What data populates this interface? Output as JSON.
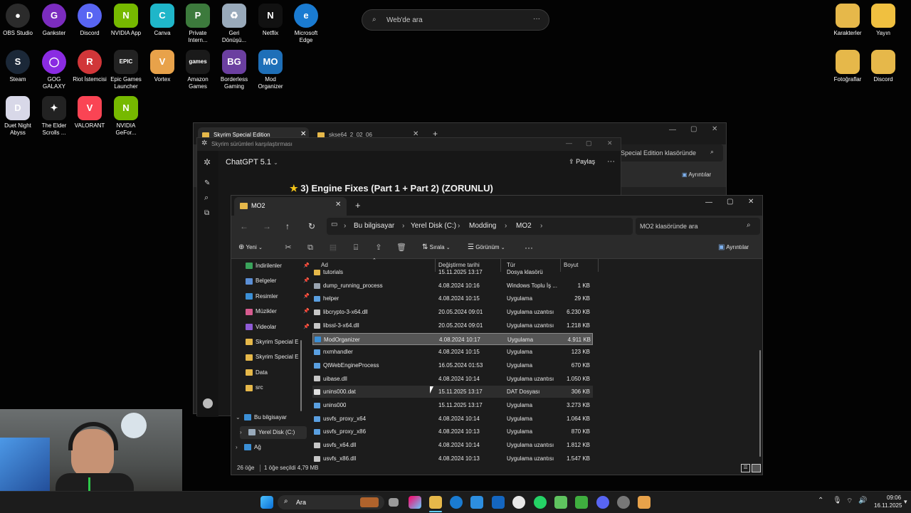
{
  "desktop_icons": [
    {
      "id": "obs",
      "label": "OBS Studio",
      "color": "#2b2b2b",
      "glyph": "●"
    },
    {
      "id": "gankster",
      "label": "Gankster",
      "color": "#7b2cbf",
      "glyph": "G"
    },
    {
      "id": "discord",
      "label": "Discord",
      "color": "#5865f2",
      "glyph": "D"
    },
    {
      "id": "nvidia",
      "label": "NVIDIA App",
      "color": "#76b900",
      "glyph": "N"
    },
    {
      "id": "canva",
      "label": "Canva",
      "color": "#1fb6c9",
      "glyph": "C"
    },
    {
      "id": "private",
      "label": "Private Intern...",
      "color": "#3c7a3c",
      "glyph": "P"
    },
    {
      "id": "recycle",
      "label": "Geri Dönüşü...",
      "color": "#9ab",
      "glyph": "♻"
    },
    {
      "id": "netflix",
      "label": "Netflix",
      "color": "#111",
      "glyph": "N"
    },
    {
      "id": "edge",
      "label": "Microsoft Edge",
      "color": "#1a7bd1",
      "glyph": "e"
    },
    {
      "id": "steam",
      "label": "Steam",
      "color": "#1b2838",
      "glyph": "S"
    },
    {
      "id": "gog",
      "label": "GOG GALAXY",
      "color": "#8a2be2",
      "glyph": "◯"
    },
    {
      "id": "riot",
      "label": "Riot İstemcisi",
      "color": "#d13639",
      "glyph": "R"
    },
    {
      "id": "epic",
      "label": "Epic Games Launcher",
      "color": "#222",
      "glyph": "EPIC"
    },
    {
      "id": "vortex",
      "label": "Vortex",
      "color": "#e8a24a",
      "glyph": "V"
    },
    {
      "id": "amazon",
      "label": "Amazon Games",
      "color": "#1a1a1a",
      "glyph": "games"
    },
    {
      "id": "borderless",
      "label": "Borderless Gaming",
      "color": "#6b3fa0",
      "glyph": "BG"
    },
    {
      "id": "mo",
      "label": "Mod Organizer",
      "color": "#1e6fb8",
      "glyph": "MO"
    },
    {
      "id": "duet",
      "label": "Duet Night Abyss",
      "color": "#d8d8e8",
      "glyph": "D"
    },
    {
      "id": "tes",
      "label": "The Elder Scrolls ...",
      "color": "#222",
      "glyph": "✦"
    },
    {
      "id": "valorant",
      "label": "VALORANT",
      "color": "#fa4454",
      "glyph": "V"
    },
    {
      "id": "nvgef",
      "label": "NVIDIA GeFor...",
      "color": "#76b900",
      "glyph": "N"
    },
    {
      "id": "karakterler",
      "label": "Karakterler",
      "color": "#e6b84a",
      "glyph": ""
    },
    {
      "id": "yayin",
      "label": "Yayın",
      "color": "#f0c040",
      "glyph": ""
    },
    {
      "id": "fotograflar",
      "label": "Fotoğraflar",
      "color": "#e6b84a",
      "glyph": ""
    },
    {
      "id": "discord_folder",
      "label": "Discord",
      "color": "#e6b84a",
      "glyph": ""
    }
  ],
  "web_search": {
    "placeholder": "Web'de ara",
    "more": "···"
  },
  "bg_explorer": {
    "tab1": "Skyrim Special Edition",
    "tab2": "skse64_2_02_06",
    "search": "Special Edition klasöründe",
    "details": "Ayrıntılar"
  },
  "chatgpt": {
    "window_title": "Skyrim sürümleri karşılaştırması",
    "model": "ChatGPT 5.1",
    "share": "Paylaş",
    "heading": "3) Engine Fixes (Part 1 + Part 2) (ZORUNLU)"
  },
  "explorer": {
    "tab_title": "MO2",
    "breadcrumbs": [
      "Bu bilgisayar",
      "Yerel Disk (C:)",
      "Modding",
      "MO2"
    ],
    "search_placeholder": "MO2 klasöründe ara",
    "toolbar": {
      "new": "Yeni",
      "sort": "Sırala",
      "view": "Görünüm",
      "more": "···",
      "details": "Ayrıntılar"
    },
    "sidebar": [
      {
        "label": "İndirilenler",
        "color": "#3aa35b",
        "pinned": true
      },
      {
        "label": "Belgeler",
        "color": "#5b8fd6",
        "pinned": true
      },
      {
        "label": "Resimler",
        "color": "#3b8fd6",
        "pinned": true
      },
      {
        "label": "Müzikler",
        "color": "#d65b8f",
        "pinned": true
      },
      {
        "label": "Videolar",
        "color": "#8f5bd6",
        "pinned": true
      },
      {
        "label": "Skyrim Special E",
        "color": "#e6b84a",
        "pinned": false
      },
      {
        "label": "Skyrim Special E",
        "color": "#e6b84a",
        "pinned": false
      },
      {
        "label": "Data",
        "color": "#e6b84a",
        "pinned": false
      },
      {
        "label": "src",
        "color": "#e6b84a",
        "pinned": false
      }
    ],
    "sidebar_tree": [
      {
        "label": "Bu bilgisayar",
        "arrow": "⌄"
      },
      {
        "label": "Yerel Disk (C:)",
        "arrow": "›"
      },
      {
        "label": "Ağ",
        "arrow": "›"
      }
    ],
    "columns": {
      "name": "Ad",
      "date": "Değiştirme tarihi",
      "type": "Tür",
      "size": "Boyut"
    },
    "files": [
      {
        "name": "tutorials",
        "date": "15.11.2025 13:17",
        "type": "Dosya klasörü",
        "size": "",
        "icon": "#e6b84a"
      },
      {
        "name": "dump_running_process",
        "date": "4.08.2024 10:16",
        "type": "Windows Toplu İş ...",
        "size": "1 KB",
        "icon": "#9aa4b0"
      },
      {
        "name": "helper",
        "date": "4.08.2024 10:15",
        "type": "Uygulama",
        "size": "29 KB",
        "icon": "#5a9fe0"
      },
      {
        "name": "libcrypto-3-x64.dll",
        "date": "20.05.2024 09:01",
        "type": "Uygulama uzantısı",
        "size": "6.230 KB",
        "icon": "#c7c7c7"
      },
      {
        "name": "libssl-3-x64.dll",
        "date": "20.05.2024 09:01",
        "type": "Uygulama uzantısı",
        "size": "1.218 KB",
        "icon": "#c7c7c7"
      },
      {
        "name": "ModOrganizer",
        "date": "4.08.2024 10:17",
        "type": "Uygulama",
        "size": "4.911 KB",
        "icon": "#3b8fd6"
      },
      {
        "name": "nxmhandler",
        "date": "4.08.2024 10:15",
        "type": "Uygulama",
        "size": "123 KB",
        "icon": "#5a9fe0"
      },
      {
        "name": "QtWebEngineProcess",
        "date": "16.05.2024 01:53",
        "type": "Uygulama",
        "size": "670 KB",
        "icon": "#5a9fe0"
      },
      {
        "name": "uibase.dll",
        "date": "4.08.2024 10:14",
        "type": "Uygulama uzantısı",
        "size": "1.050 KB",
        "icon": "#c7c7c7"
      },
      {
        "name": "unins000.dat",
        "date": "15.11.2025 13:17",
        "type": "DAT Dosyası",
        "size": "306 KB",
        "icon": "#e0e0e0"
      },
      {
        "name": "unins000",
        "date": "15.11.2025 13:17",
        "type": "Uygulama",
        "size": "3.273 KB",
        "icon": "#5a9fe0"
      },
      {
        "name": "usvfs_proxy_x64",
        "date": "4.08.2024 10:14",
        "type": "Uygulama",
        "size": "1.064 KB",
        "icon": "#5a9fe0"
      },
      {
        "name": "usvfs_proxy_x86",
        "date": "4.08.2024 10:13",
        "type": "Uygulama",
        "size": "870 KB",
        "icon": "#5a9fe0"
      },
      {
        "name": "usvfs_x64.dll",
        "date": "4.08.2024 10:14",
        "type": "Uygulama uzantısı",
        "size": "1.812 KB",
        "icon": "#c7c7c7"
      },
      {
        "name": "usvfs_x86.dll",
        "date": "4.08.2024 10:13",
        "type": "Uygulama uzantısı",
        "size": "1.547 KB",
        "icon": "#c7c7c7"
      }
    ],
    "status": {
      "count": "26 öğe",
      "selected": "1 öğe seçildi  4,79 MB"
    }
  },
  "taskbar": {
    "search": "Ara",
    "time": "09:06",
    "date": "16.11.2025"
  }
}
